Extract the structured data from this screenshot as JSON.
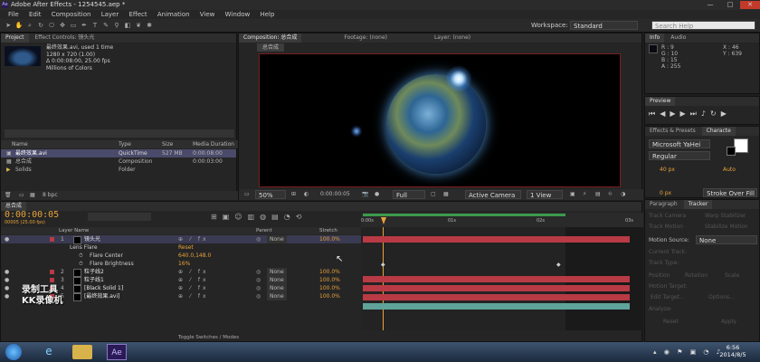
{
  "window": {
    "title": "Adobe After Effects - 1254545.aep *",
    "min": "—",
    "max": "□",
    "close": "✕"
  },
  "menu": [
    "File",
    "Edit",
    "Composition",
    "Layer",
    "Effect",
    "Animation",
    "View",
    "Window",
    "Help"
  ],
  "workspace": {
    "label": "Workspace:",
    "value": "Standard",
    "search_placeholder": "Search Help"
  },
  "project": {
    "tab": "Project",
    "effect_tab": "Effect Controls: 镜头光",
    "preview": {
      "name": "最终效果.avi",
      "info": ", used 1 time",
      "res": "1280 x 720 (1.00)",
      "dur": "Δ 0:00:08:00, 25.00 fps",
      "colors": "Millions of Colors"
    },
    "headers": [
      "Name",
      "Type",
      "Size",
      "Media Duration"
    ],
    "items": [
      {
        "name": "最终效果.avi",
        "type": "QuickTime",
        "size": "527 MB",
        "dur": "0:00:08:00"
      },
      {
        "name": "总合成",
        "type": "Composition",
        "size": "",
        "dur": "0:00:03:00"
      },
      {
        "name": "Solids",
        "type": "Folder",
        "size": "",
        "dur": ""
      }
    ],
    "bpc": "8 bpc"
  },
  "comp": {
    "tabs": [
      "Composition: 总合成",
      "Footage: (none)",
      "Layer: (none)"
    ],
    "chip": "总合成",
    "zoom": "50%",
    "time": "0:00:00:05",
    "res": "Full",
    "camera": "Active Camera",
    "views": "1 View"
  },
  "info": {
    "tab": "Info",
    "audio_tab": "Audio",
    "r": "R : 9",
    "g": "G : 10",
    "b": "B : 15",
    "a": "A : 255",
    "x": "X : 46",
    "y": "Y : 639"
  },
  "preview_panel": {
    "tab": "Preview"
  },
  "effects_panel": {
    "tab": "Effects & Presets",
    "char_tab": "Characte",
    "font": "Microsoft YaHei",
    "style": "Regular",
    "size": "40 px",
    "leading": "Auto",
    "tracking": "0 px",
    "stroke": "Stroke Over Fill"
  },
  "tracker": {
    "tabs": [
      "Paragraph",
      "Tracker"
    ],
    "motion_source_label": "Motion Source:",
    "motion_source": "None",
    "items": [
      "Track Camera",
      "Warp Stabilizer",
      "Track Motion",
      "Stabilize Motion",
      "Current Track:",
      "Track Type:",
      "Position",
      "Rotation",
      "Scale",
      "Motion Target:",
      "Edit Target...",
      "Options...",
      "Analyze:",
      "Reset",
      "Apply"
    ]
  },
  "timeline": {
    "tab": "总合成",
    "time": "0:00:00:05",
    "fps": "00005 (25.00 fps)",
    "search_placeholder": "",
    "headers": {
      "layer": "Layer Name",
      "parent": "Parent",
      "stretch": "Stretch"
    },
    "ruler": [
      "0:00s",
      "01s",
      "02s",
      "03s"
    ],
    "layers": [
      {
        "num": "1",
        "name": "镜头光",
        "parent": "None",
        "stretch": "100.0%",
        "selected": true
      },
      {
        "num": "",
        "name": "Lens Flare",
        "parent": "",
        "stretch": "",
        "sub": true,
        "value": "Reset"
      },
      {
        "num": "",
        "name": "Flare Center",
        "parent": "",
        "stretch": "",
        "sub2": true,
        "value": "640.0,148.0"
      },
      {
        "num": "",
        "name": "Flare Brightness",
        "parent": "",
        "stretch": "",
        "sub2": true,
        "value": "16%"
      },
      {
        "num": "2",
        "name": "粒子线2",
        "parent": "None",
        "stretch": "100.0%"
      },
      {
        "num": "3",
        "name": "粒子线1",
        "parent": "None",
        "stretch": "100.0%"
      },
      {
        "num": "4",
        "name": "[Black Solid 1]",
        "parent": "None",
        "stretch": "100.0%"
      },
      {
        "num": "5",
        "name": "[最终效果.avi]",
        "parent": "None",
        "stretch": "100.0%"
      }
    ],
    "toggle": "Toggle Switches / Modes"
  },
  "watermark": {
    "line1": "录制工具",
    "line2": "KK录像机"
  },
  "taskbar": {
    "time": "6:56",
    "date": "2014/8/5",
    "ae": "Ae"
  },
  "colors": {
    "accent": "#e8a33a",
    "bar_red": "#b83a44",
    "bar_teal": "#5fa39a",
    "work_green": "#3c9a4c"
  }
}
